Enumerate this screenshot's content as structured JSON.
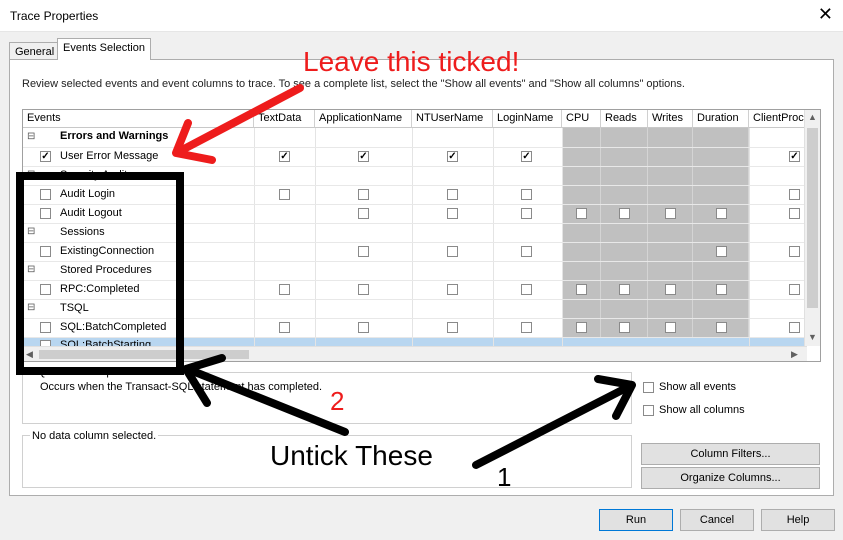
{
  "window": {
    "title": "Trace Properties"
  },
  "tabs": [
    {
      "label": "General",
      "active": false
    },
    {
      "label": "Events Selection",
      "active": true
    }
  ],
  "description": "Review selected events and event columns to trace. To see a complete list, select the \"Show all events\" and \"Show all columns\" options.",
  "grid": {
    "columns": [
      "Events",
      "TextData",
      "ApplicationName",
      "NTUserName",
      "LoginName",
      "CPU",
      "Reads",
      "Writes",
      "Duration",
      "ClientProc"
    ],
    "rows": [
      {
        "type": "category",
        "label": "Errors and Warnings",
        "bold": true
      },
      {
        "type": "event",
        "label": "User Error Message",
        "checked": true,
        "cells": [
          "checked",
          "checked",
          "checked",
          "checked",
          "none",
          "none",
          "none",
          "none",
          "checked"
        ]
      },
      {
        "type": "category",
        "label": "Security Audit"
      },
      {
        "type": "event",
        "label": "Audit Login",
        "checked": false,
        "cells": [
          "empty",
          "empty",
          "empty",
          "empty",
          "none",
          "none",
          "none",
          "none",
          "empty"
        ]
      },
      {
        "type": "event",
        "label": "Audit Logout",
        "checked": false,
        "cells": [
          "none",
          "empty",
          "empty",
          "empty",
          "empty",
          "empty",
          "empty",
          "empty",
          "empty"
        ]
      },
      {
        "type": "category",
        "label": "Sessions"
      },
      {
        "type": "event",
        "label": "ExistingConnection",
        "checked": false,
        "cells": [
          "none",
          "empty",
          "empty",
          "empty",
          "none",
          "none",
          "none",
          "empty",
          "empty"
        ]
      },
      {
        "type": "category",
        "label": "Stored Procedures"
      },
      {
        "type": "event",
        "label": "RPC:Completed",
        "checked": false,
        "cells": [
          "empty",
          "empty",
          "empty",
          "empty",
          "empty",
          "empty",
          "empty",
          "empty",
          "empty"
        ]
      },
      {
        "type": "category",
        "label": "TSQL"
      },
      {
        "type": "event",
        "label": "SQL:BatchCompleted",
        "checked": false,
        "cells": [
          "empty",
          "empty",
          "empty",
          "empty",
          "empty",
          "empty",
          "empty",
          "empty",
          "empty"
        ]
      },
      {
        "type": "event",
        "label": "SQL:BatchStarting",
        "checked": false,
        "selected": true,
        "cells": [
          "empty",
          "empty",
          "empty",
          "empty",
          "none",
          "none",
          "none",
          "none",
          "empty"
        ]
      }
    ]
  },
  "event_info": {
    "title": "SQL:BatchCompleted",
    "text": "Occurs when the Transact-SQL statement has completed."
  },
  "column_info": {
    "text": "No data column selected."
  },
  "options": {
    "show_all_events": {
      "label": "Show all events",
      "checked": false
    },
    "show_all_columns": {
      "label": "Show all columns",
      "checked": false
    }
  },
  "buttons": {
    "column_filters": "Column Filters...",
    "organize_columns": "Organize Columns...",
    "run": "Run",
    "cancel": "Cancel",
    "help": "Help"
  },
  "annotations": {
    "leave_ticked": "Leave this ticked!",
    "untick": "Untick These",
    "num1": "1",
    "num2": "2",
    "color_red": "#ee1c1c",
    "color_black": "#000000"
  }
}
